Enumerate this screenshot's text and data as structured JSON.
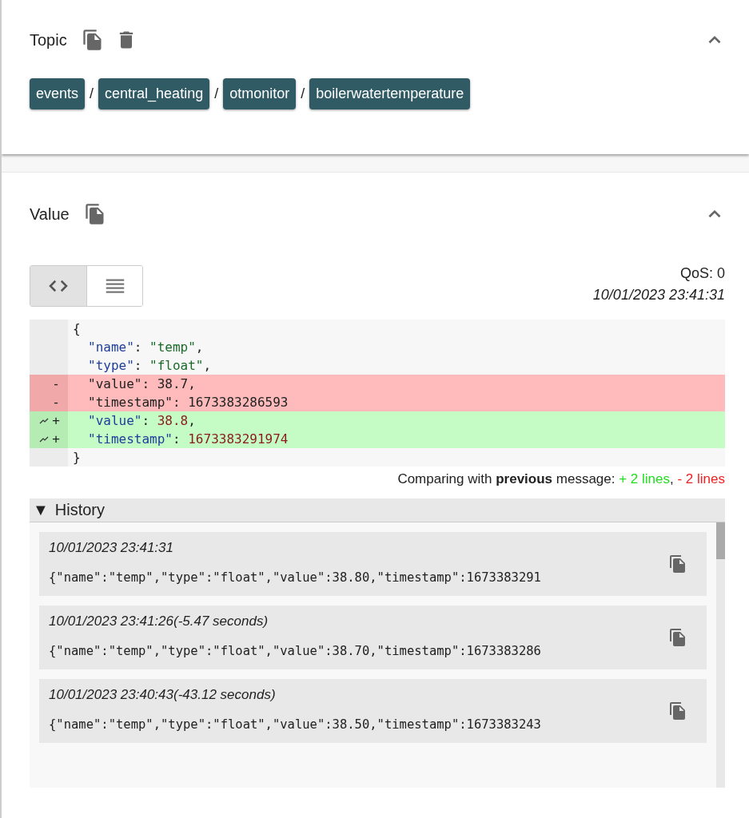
{
  "topic": {
    "title": "Topic",
    "expanded": true,
    "path": [
      {
        "kind": "chip",
        "text": "events"
      },
      {
        "kind": "separator",
        "text": "/"
      },
      {
        "kind": "chip",
        "text": "central_heating"
      },
      {
        "kind": "separator",
        "text": "/"
      },
      {
        "kind": "chip",
        "text": "otmonitor"
      },
      {
        "kind": "separator",
        "text": "/"
      },
      {
        "kind": "chip",
        "text": "boilerwatertemperature"
      }
    ]
  },
  "value": {
    "title": "Value",
    "expanded": true,
    "view_modes": [
      {
        "kind": "code",
        "selected": true
      },
      {
        "kind": "list",
        "selected": false
      }
    ],
    "qos": "QoS: 0",
    "timestamp": "10/01/2023 23:41:31",
    "diff_lines": [
      {
        "kind": "context",
        "indent": false,
        "parts": [
          {
            "kind": "punct",
            "text": "{"
          }
        ]
      },
      {
        "kind": "context",
        "indent": true,
        "parts": [
          {
            "kind": "key",
            "text": "\"name\""
          },
          {
            "kind": "punct",
            "text": ": "
          },
          {
            "kind": "string",
            "text": "\"temp\""
          },
          {
            "kind": "punct",
            "text": ","
          }
        ]
      },
      {
        "kind": "context",
        "indent": true,
        "parts": [
          {
            "kind": "key",
            "text": "\"type\""
          },
          {
            "kind": "punct",
            "text": ": "
          },
          {
            "kind": "string",
            "text": "\"float\""
          },
          {
            "kind": "punct",
            "text": ","
          }
        ]
      },
      {
        "kind": "removed",
        "indent": true,
        "sign": "-",
        "parts": [
          {
            "kind": "punct",
            "text": "\"value\": 38.7,"
          }
        ]
      },
      {
        "kind": "removed",
        "indent": true,
        "sign": "-",
        "parts": [
          {
            "kind": "punct",
            "text": "\"timestamp\": 1673383286593"
          }
        ]
      },
      {
        "kind": "added",
        "indent": true,
        "sign": "+",
        "parts": [
          {
            "kind": "key",
            "text": "\"value\""
          },
          {
            "kind": "punct",
            "text": ": "
          },
          {
            "kind": "number",
            "text": "38.8"
          },
          {
            "kind": "punct",
            "text": ","
          }
        ]
      },
      {
        "kind": "added",
        "indent": true,
        "sign": "+",
        "parts": [
          {
            "kind": "key",
            "text": "\"timestamp\""
          },
          {
            "kind": "punct",
            "text": ": "
          },
          {
            "kind": "number",
            "text": "1673383291974"
          }
        ]
      },
      {
        "kind": "context",
        "indent": false,
        "parts": [
          {
            "kind": "punct",
            "text": "}"
          }
        ]
      }
    ],
    "comparison": [
      {
        "kind": "plain",
        "text": "Comparing with **previous** message: "
      },
      {
        "kind": "added",
        "text": "+ 2 lines"
      },
      {
        "kind": "plain",
        "text": ", "
      },
      {
        "kind": "removed",
        "text": "- 2 lines"
      }
    ],
    "history": {
      "toggle": "▼",
      "title": "History",
      "items": [
        {
          "time": "10/01/2023 23:41:31",
          "payload": "{\"name\":\"temp\",\"type\":\"float\",\"value\":38.80,\"timestamp\":1673383291"
        },
        {
          "time": "10/01/2023 23:41:26(-5.47 seconds)",
          "payload": "{\"name\":\"temp\",\"type\":\"float\",\"value\":38.70,\"timestamp\":1673383286"
        },
        {
          "time": "10/01/2023 23:40:43(-43.12 seconds)",
          "payload": "{\"name\":\"temp\",\"type\":\"float\",\"value\":38.50,\"timestamp\":1673383243"
        }
      ]
    }
  }
}
